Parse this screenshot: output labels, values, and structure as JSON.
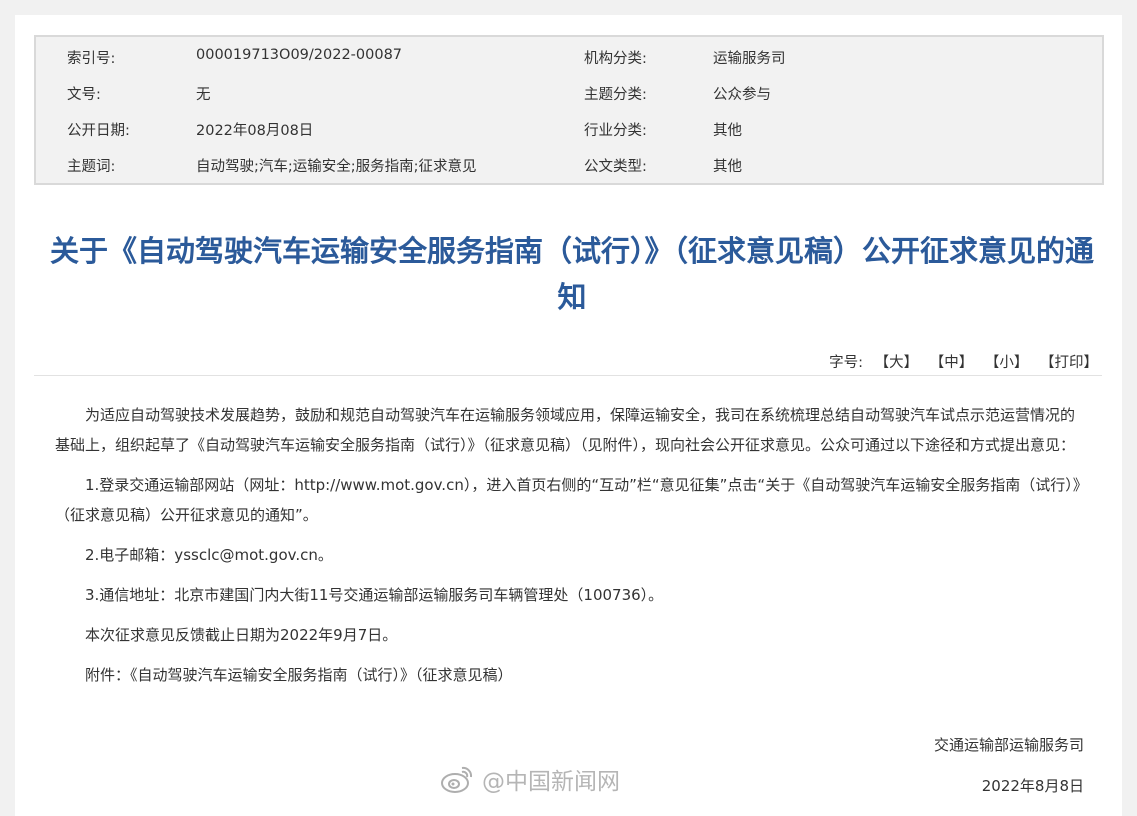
{
  "meta": {
    "rows": [
      {
        "label1": "索引号:",
        "value1": "000019713O09/2022-00087",
        "label2": "机构分类:",
        "value2": "运输服务司"
      },
      {
        "label1": "文号:",
        "value1": "无",
        "label2": "主题分类:",
        "value2": "公众参与"
      },
      {
        "label1": "公开日期:",
        "value1": "2022年08月08日",
        "label2": "行业分类:",
        "value2": "其他"
      },
      {
        "label1": "主题词:",
        "value1": "自动驾驶;汽车;运输安全;服务指南;征求意见",
        "label2": "公文类型:",
        "value2": "其他"
      }
    ]
  },
  "title": "关于《自动驾驶汽车运输安全服务指南（试行）》（征求意见稿）公开征求意见的通知",
  "font_options": {
    "label": "字号:",
    "large": "【大】",
    "medium": "【中】",
    "small": "【小】",
    "print": "【打印】"
  },
  "body": {
    "intro": "为适应自动驾驶技术发展趋势，鼓励和规范自动驾驶汽车在运输服务领域应用，保障运输安全，我司在系统梳理总结自动驾驶汽车试点示范运营情况的基础上，组织起草了《自动驾驶汽车运输安全服务指南（试行）》（征求意见稿）（见附件），现向社会公开征求意见。公众可通过以下途径和方式提出意见：",
    "item1": "1.登录交通运输部网站（网址：http://www.mot.gov.cn），进入首页右侧的“互动”栏“意见征集”点击“关于《自动驾驶汽车运输安全服务指南（试行）》（征求意见稿）公开征求意见的通知”。",
    "item2": "2.电子邮箱：yssclc@mot.gov.cn。",
    "item3": "3.通信地址：北京市建国门内大街11号交通运输部运输服务司车辆管理处（100736）。",
    "deadline": "本次征求意见反馈截止日期为2022年9月7日。",
    "attachment": "附件：《自动驾驶汽车运输安全服务指南（试行）》（征求意见稿）"
  },
  "signature": {
    "org": "交通运输部运输服务司",
    "date": "2022年8月8日"
  },
  "watermark": {
    "text": "@中国新闻网",
    "icon": "weibo-icon"
  }
}
